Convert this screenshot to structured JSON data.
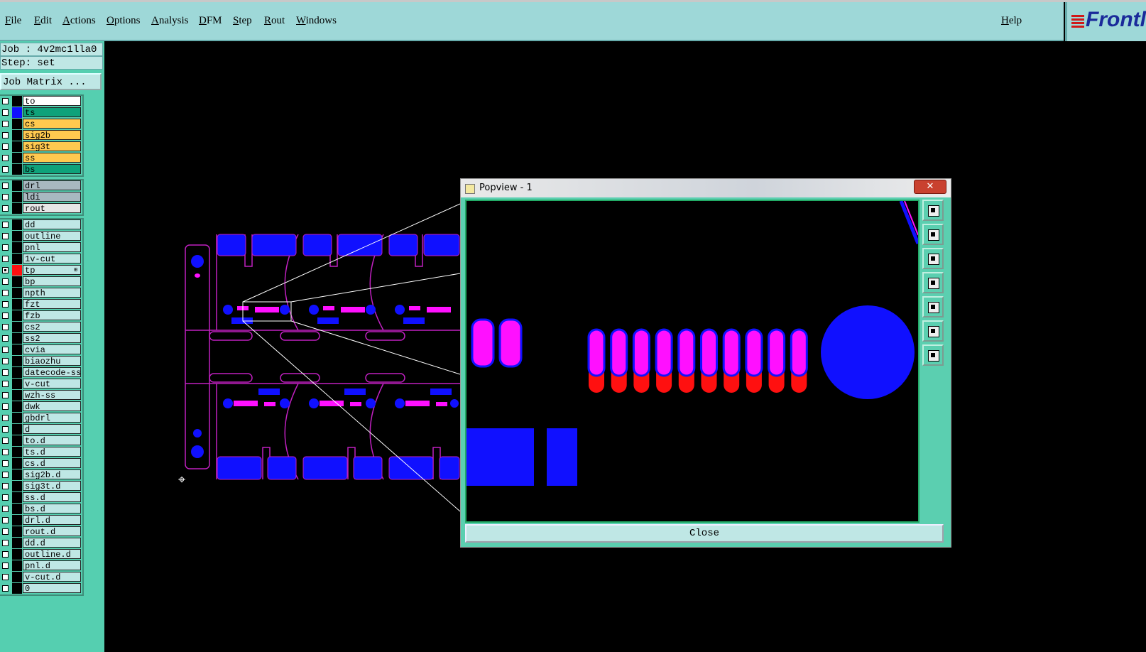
{
  "menubar": {
    "items": [
      "File",
      "Edit",
      "Actions",
      "Options",
      "Analysis",
      "DFM",
      "Step",
      "Rout",
      "Windows"
    ],
    "help": "Help"
  },
  "logo": {
    "text": "Frontl"
  },
  "info": {
    "job": "Job : 4v2mc1lla0",
    "step": "Step: set",
    "job_matrix": "Job Matrix ..."
  },
  "layer_groups": [
    [
      {
        "name": "to",
        "color": "#ffffff"
      },
      {
        "name": "ts",
        "color": "#0ea27a",
        "swatch": "#1010ff"
      },
      {
        "name": "cs",
        "color": "#ffc94f"
      },
      {
        "name": "sig2b",
        "color": "#ffc94f"
      },
      {
        "name": "sig3t",
        "color": "#ffc94f"
      },
      {
        "name": "ss",
        "color": "#ffc94f"
      },
      {
        "name": "bs",
        "color": "#0ea27a"
      }
    ],
    [
      {
        "name": "drl",
        "color": "#a8b8c0"
      },
      {
        "name": "ldi",
        "color": "#a8b8c0"
      },
      {
        "name": "rout",
        "color": "#e6e6e6"
      }
    ],
    [
      {
        "name": "dd"
      },
      {
        "name": "outline"
      },
      {
        "name": "pnl"
      },
      {
        "name": "1v-cut"
      },
      {
        "name": "tp",
        "swatch": "#ff1010",
        "checked": true,
        "marker": "⊞"
      },
      {
        "name": "bp"
      },
      {
        "name": "npth"
      },
      {
        "name": "fzt"
      },
      {
        "name": "fzb"
      },
      {
        "name": "cs2"
      },
      {
        "name": "ss2"
      },
      {
        "name": "cvia"
      },
      {
        "name": "biaozhu"
      },
      {
        "name": "datecode-ss"
      },
      {
        "name": "v-cut"
      },
      {
        "name": "wzh-ss"
      },
      {
        "name": "dwk"
      },
      {
        "name": "gbdrl"
      },
      {
        "name": "d"
      },
      {
        "name": "to.d"
      },
      {
        "name": "ts.d"
      },
      {
        "name": "cs.d"
      },
      {
        "name": "sig2b.d"
      },
      {
        "name": "sig3t.d"
      },
      {
        "name": "ss.d"
      },
      {
        "name": "bs.d"
      },
      {
        "name": "drl.d"
      },
      {
        "name": "rout.d"
      },
      {
        "name": "dd.d"
      },
      {
        "name": "outline.d"
      },
      {
        "name": "pnl.d"
      },
      {
        "name": "v-cut.d"
      },
      {
        "name": "0"
      }
    ]
  ],
  "popview": {
    "title": "Popview - 1",
    "close_label": "Close",
    "close_x": "✕"
  },
  "tools": [
    "zoom-fit-icon",
    "pan-up-icon",
    "pan-down-icon",
    "pan-left-icon",
    "pan-right-icon",
    "zoom-out-icon",
    "zoom-in-icon"
  ],
  "colors": {
    "pad_blue": "#1010ff",
    "pad_magenta": "#ff10ff",
    "pad_red": "#ff1010",
    "outline": "#c020c0"
  }
}
